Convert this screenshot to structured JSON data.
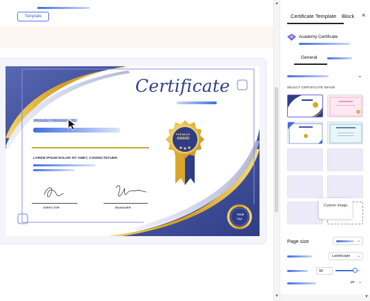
{
  "toolbar": {
    "template_button": "Template"
  },
  "certificate": {
    "title": "Certificate",
    "proudly_label": "PROUDLY PRESENTS TO",
    "lorem_text": "LOREM IPSUM DOLOR SIT AMET, CONSECTETUER",
    "award_line1": "PREMIUM",
    "award_line2": "AWARD",
    "badge_line1": "YOUR",
    "badge_line2": "Sign",
    "signatures": [
      {
        "label": "DIRECTOR"
      },
      {
        "label": "MANAGER"
      }
    ]
  },
  "panel": {
    "tabs": [
      {
        "label": "Certificate Template"
      },
      {
        "label": "Block"
      }
    ],
    "active_tab": "Certificate Template",
    "close_label": "×",
    "app_name": "Academy Certificate",
    "sub_tab": "General",
    "section_label": "SELECT CERTIFICATE IMAGE",
    "custom_image_label": "Custom Image",
    "page_size_label": "Page size",
    "orientation_value": "Landscape",
    "number_value": "90",
    "unit_value": "px",
    "slider_value": 0.78
  },
  "colors": {
    "accent": "#3f6fe0",
    "navy": "#2f3f88",
    "gold": "#d9a82a",
    "panel_bg": "#eceaf9"
  },
  "icons": {
    "close": "close-icon",
    "app": "diamond-icon",
    "chevron": "chevron-down-icon",
    "cursor": "pointer-cursor-icon",
    "award": "award-ribbon-icon",
    "seal": "seal-badge-icon"
  }
}
